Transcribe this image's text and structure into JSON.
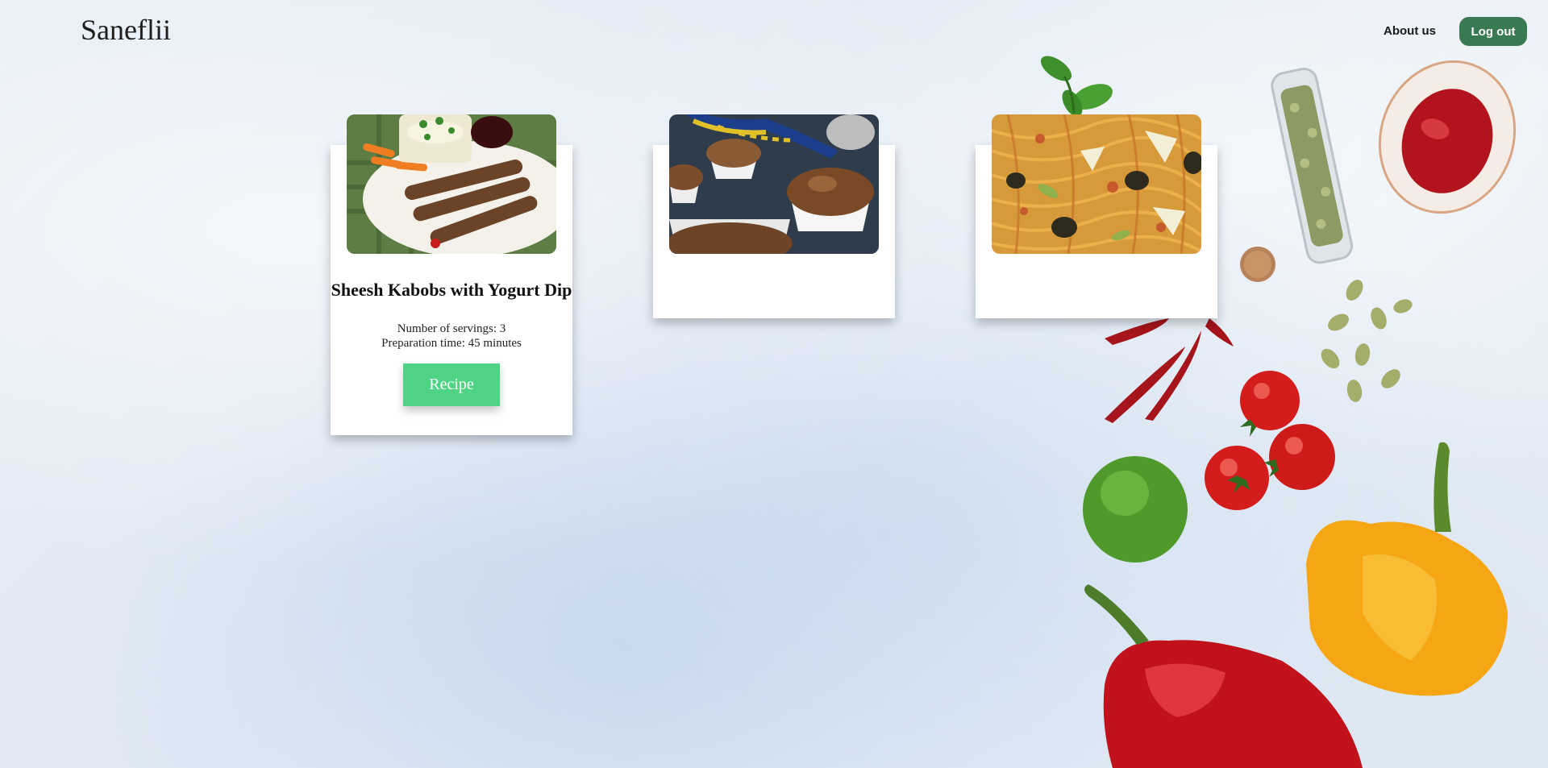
{
  "header": {
    "brand": "Saneflii",
    "about_label": "About us",
    "logout_label": "Log out"
  },
  "recipes": [
    {
      "title": "Sheesh Kabobs with Yogurt Dip",
      "servings": "Number of servings: 3",
      "prep_time": "Preparation time: 45 minutes",
      "button_label": "Recipe"
    }
  ],
  "colors": {
    "logout_bg": "#3a7a52",
    "recipe_button_bg": "#4fd486",
    "card_bg": "#ffffff"
  }
}
